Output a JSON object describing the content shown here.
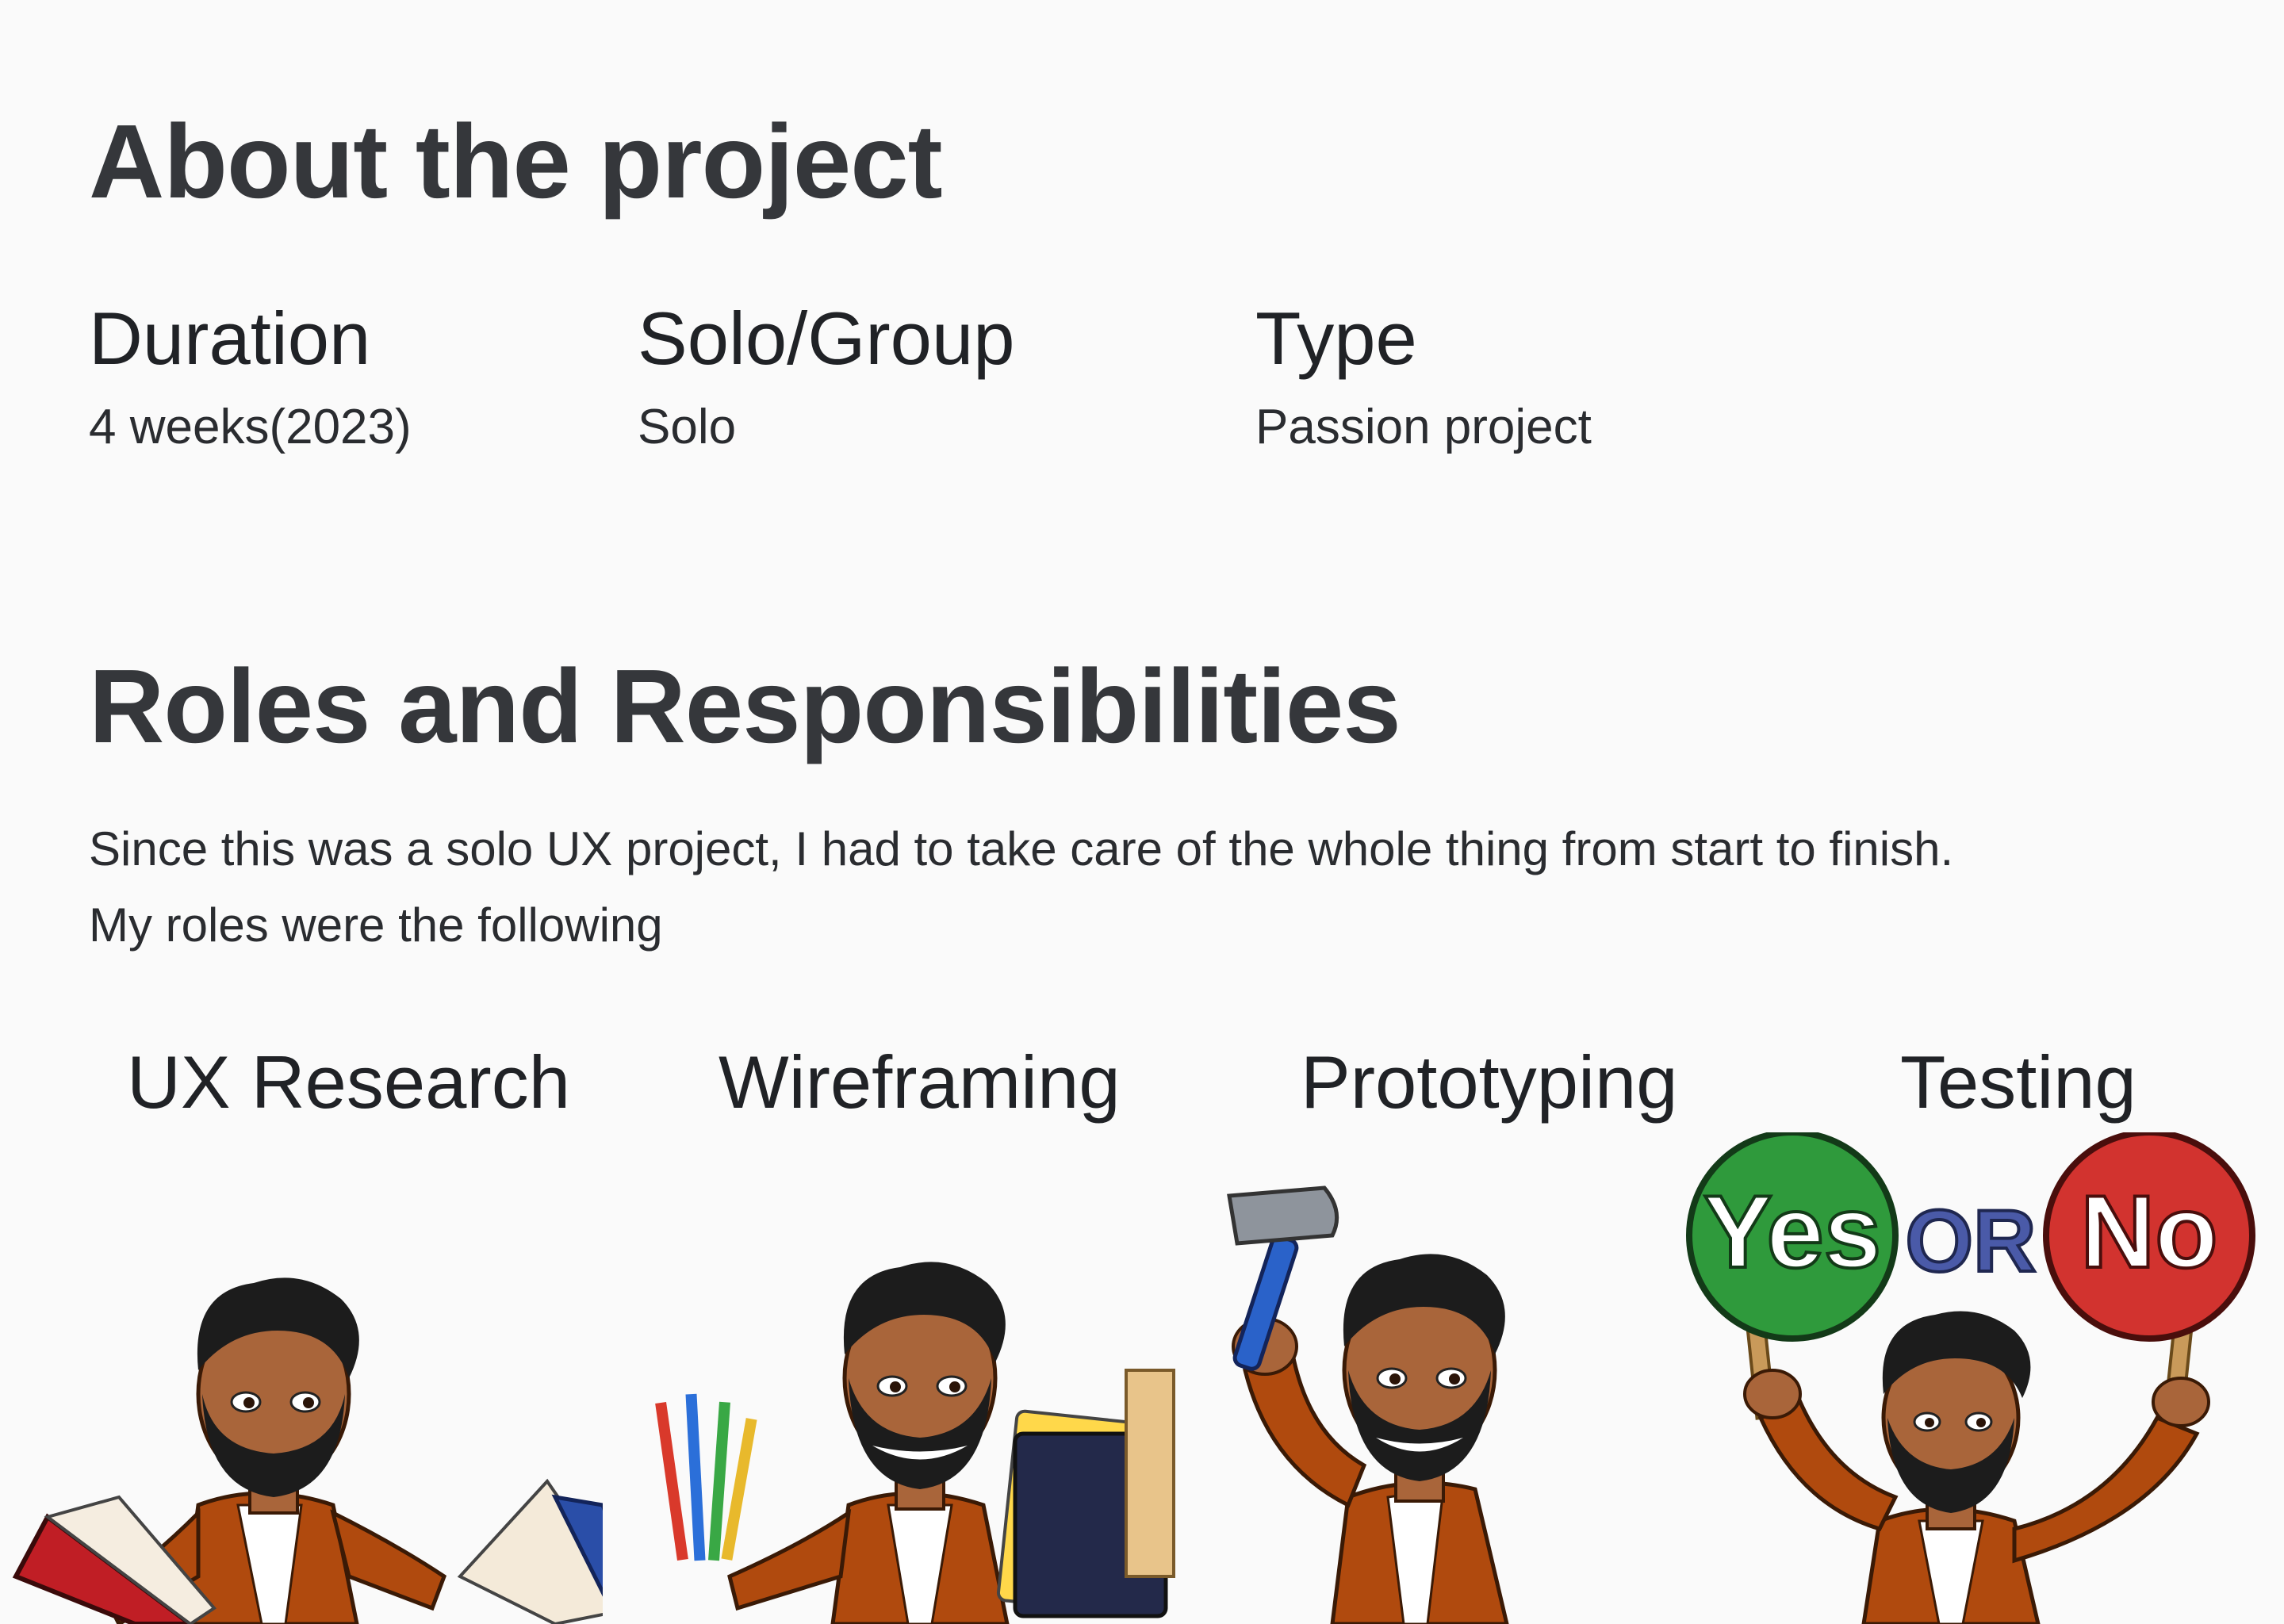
{
  "about": {
    "title": "About the project",
    "meta": [
      {
        "label": "Duration",
        "value": "4 weeks(2023)"
      },
      {
        "label": "Solo/Group",
        "value": "Solo"
      },
      {
        "label": "Type",
        "value": "Passion project"
      }
    ]
  },
  "roles": {
    "title": "Roles and Responsibilities",
    "description_line1": "Since this was a solo UX project, I had to take care of the whole thing from start to finish.",
    "description_line2": "My roles were the following",
    "items": [
      {
        "label": "UX Research",
        "icon": "avatar-reading-books-icon"
      },
      {
        "label": "Wireframing",
        "icon": "avatar-art-supplies-icon"
      },
      {
        "label": "Prototyping",
        "icon": "avatar-hammer-icon"
      },
      {
        "label": "Testing",
        "icon": "avatar-yes-or-no-signs-icon"
      }
    ],
    "signs": {
      "yes": "Yes",
      "or": "OR",
      "no": "No"
    }
  },
  "colors": {
    "background": "#fafafa",
    "heading": "#35373b",
    "jacket": "#b04a0e",
    "skin": "#a9653a",
    "hair": "#1c1c1c",
    "yes_sign": "#2f9a3c",
    "no_sign": "#d2332f",
    "or_text": "#4a5aa8"
  }
}
